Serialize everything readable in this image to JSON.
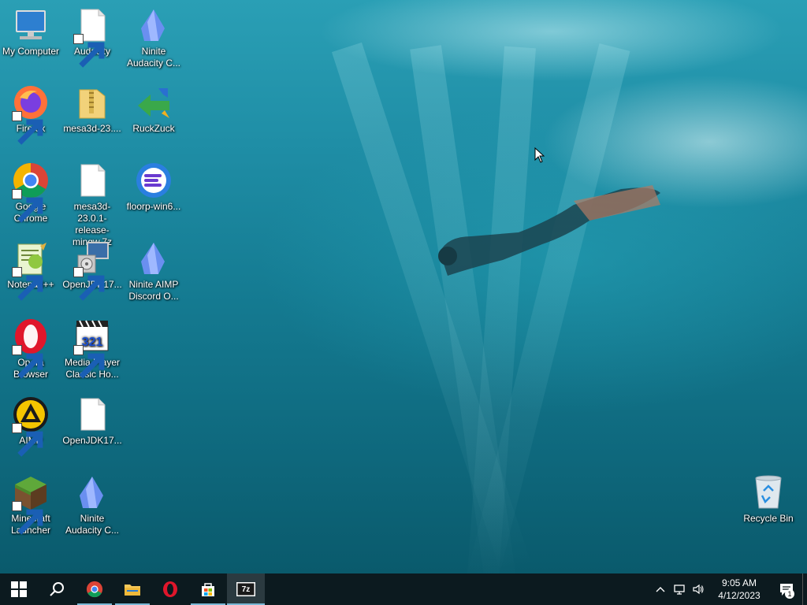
{
  "desktop_icons": [
    {
      "label": "My Computer",
      "icon": "computer-icon"
    },
    {
      "label": "Audacity",
      "icon": "blank-file-icon"
    },
    {
      "label": "Ninite Audacity C...",
      "icon": "ninite-icon"
    },
    {
      "label": "Firefox",
      "icon": "firefox-icon"
    },
    {
      "label": "mesa3d-23....",
      "icon": "folder-zip-icon"
    },
    {
      "label": "RuckZuck",
      "icon": "ruckzuck-icon"
    },
    {
      "label": "Google Chrome",
      "icon": "chrome-icon"
    },
    {
      "label": "mesa3d-23.0.1-release-mingw.7z",
      "icon": "blank-file-icon"
    },
    {
      "label": "floorp-win6...",
      "icon": "floorp-icon"
    },
    {
      "label": "Notepad++",
      "icon": "notepadpp-icon"
    },
    {
      "label": "OpenJDK17...",
      "icon": "installer-icon"
    },
    {
      "label": "Ninite AIMP Discord O...",
      "icon": "ninite-icon"
    },
    {
      "label": "Opera Browser",
      "icon": "opera-icon"
    },
    {
      "label": "Media Player Classic Ho...",
      "icon": "mpc-icon"
    },
    {
      "label": "AIMP",
      "icon": "aimp-icon"
    },
    {
      "label": "OpenJDK17...",
      "icon": "blank-file-icon"
    },
    {
      "label": "Minecraft Launcher",
      "icon": "minecraft-icon"
    },
    {
      "label": "Ninite Audacity C...",
      "icon": "ninite-icon"
    },
    {
      "label": "Recycle Bin",
      "icon": "recycle-bin-icon"
    }
  ],
  "taskbar": {
    "pinned": [
      "start-icon",
      "search-icon",
      "chrome-icon",
      "file-explorer-icon",
      "opera-icon",
      "store-icon",
      "7zip-icon"
    ],
    "seven_zip_label": "7z"
  },
  "tray": {
    "time": "9:05 AM",
    "date": "4/12/2023",
    "notification_count": "1"
  },
  "colors": {
    "taskbar": "#0c1a1f",
    "accent": "#7ab8d6",
    "water": "#1f8ea6"
  }
}
